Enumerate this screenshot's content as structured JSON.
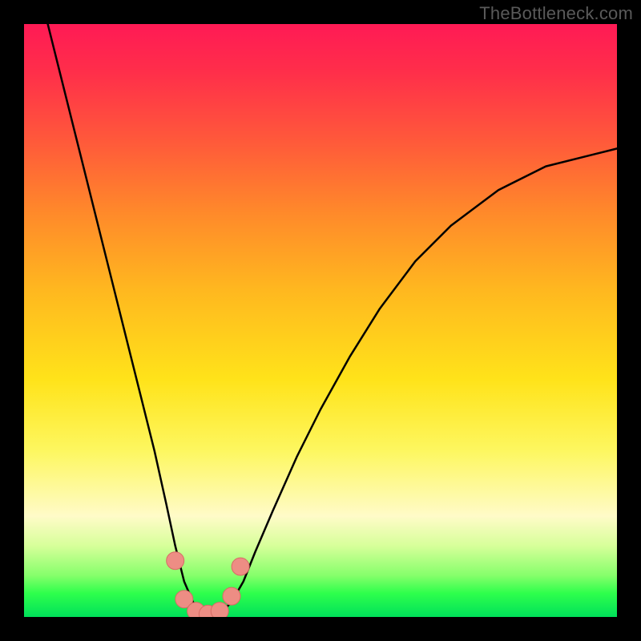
{
  "watermark": {
    "text": "TheBottleneck.com"
  },
  "colors": {
    "frame_bg": "#000000",
    "curve_stroke": "#000000",
    "dot_fill": "#ed8d84",
    "dot_stroke": "#d76b64"
  },
  "chart_data": {
    "type": "line",
    "title": "",
    "xlabel": "",
    "ylabel": "",
    "x": [
      0.04,
      0.06,
      0.08,
      0.1,
      0.12,
      0.14,
      0.16,
      0.18,
      0.2,
      0.22,
      0.24,
      0.255,
      0.27,
      0.285,
      0.3,
      0.32,
      0.335,
      0.35,
      0.37,
      0.39,
      0.42,
      0.46,
      0.5,
      0.55,
      0.6,
      0.66,
      0.72,
      0.8,
      0.88,
      0.96,
      1.0
    ],
    "values": [
      1.0,
      0.92,
      0.84,
      0.76,
      0.68,
      0.6,
      0.52,
      0.44,
      0.36,
      0.28,
      0.19,
      0.12,
      0.06,
      0.025,
      0.01,
      0.005,
      0.01,
      0.025,
      0.06,
      0.11,
      0.18,
      0.27,
      0.35,
      0.44,
      0.52,
      0.6,
      0.66,
      0.72,
      0.76,
      0.78,
      0.79
    ],
    "ylim": [
      0,
      1
    ],
    "xlim": [
      0,
      1
    ],
    "markers": {
      "x": [
        0.255,
        0.27,
        0.29,
        0.31,
        0.33,
        0.35,
        0.365
      ],
      "y": [
        0.095,
        0.03,
        0.01,
        0.005,
        0.01,
        0.035,
        0.085
      ]
    }
  }
}
